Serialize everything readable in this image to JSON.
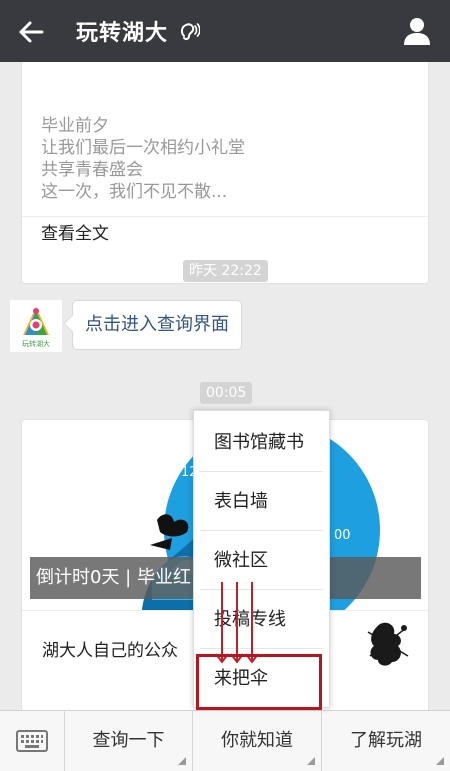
{
  "header": {
    "title": "玩转湖大"
  },
  "article1": {
    "excerpt_lines": [
      "毕业前夕",
      "让我们最后一次相约小礼堂",
      "共享青春盛会",
      "这一次，我们不见不散..."
    ],
    "read_more": "查看全文"
  },
  "timestamps": {
    "first": "昨天 22:22",
    "second": "00:05"
  },
  "message": {
    "text": "点击进入查询界面",
    "avatar_caption": "玩转湖大"
  },
  "article2": {
    "cover_caption": "倒计时0天 | 毕业红… …单",
    "cover_numbers": [
      "12",
      "00"
    ],
    "subtitle": "湖大人自己的公众"
  },
  "popup_menu": {
    "items": [
      "图书馆藏书",
      "表白墙",
      "微社区",
      "投稿专线",
      "来把伞"
    ]
  },
  "bottom_menu": {
    "items": [
      "查询一下",
      "你就知道",
      "了解玩湖"
    ]
  },
  "colors": {
    "header_bg": "#393a3f",
    "highlight": "#b5161f",
    "link_blue": "#33557f",
    "arrow_red": "#c0202a"
  }
}
